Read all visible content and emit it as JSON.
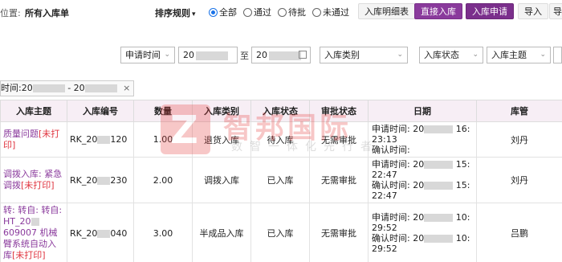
{
  "header": {
    "location_label": "位置:",
    "location_value": "所有入库单",
    "sort_label": "排序规则",
    "sort_caret": "▾",
    "radio_options": [
      "全部",
      "通过",
      "待批",
      "未通过"
    ],
    "radio_selected": "全部",
    "buttons": {
      "detail_table": "入库明细表",
      "direct_inbound": "直接入库",
      "inbound_request": "入库申请",
      "import": "导入",
      "more": "导"
    }
  },
  "filters": {
    "time_type": "申请时间",
    "date_from": "20",
    "to_label": "至",
    "date_to": "20",
    "inbound_category": "入库类别",
    "inbound_status": "入库状态",
    "inbound_subject": "入库主题"
  },
  "chip": {
    "prefix": "时间:20",
    "middle": "- 20",
    "close": "×"
  },
  "table": {
    "columns": [
      "入库主题",
      "入库编号",
      "数量",
      "入库类别",
      "入库状态",
      "审批状态",
      "日期",
      "库管"
    ],
    "rows": [
      {
        "subject": "质量问题",
        "subject_tag": "[未打印]",
        "code_prefix": "RK_20",
        "code_suffix": "120",
        "quantity": "1.00",
        "category": "退货入库",
        "status": "待入库",
        "approval": "无需审批",
        "date_apply_label": "申请时间:",
        "date_apply_prefix": "20",
        "date_apply_suffix": "16:",
        "date_apply_time": "23:13",
        "date_confirm_label": "确认时间:",
        "date_confirm_time": "",
        "keeper": "刘丹"
      },
      {
        "subject": "调拨入库: 紧急调拨",
        "subject_tag": "[未打印]",
        "code_prefix": "RK_20",
        "code_suffix": "230",
        "quantity": "2.00",
        "category": "调拨入库",
        "status": "已入库",
        "approval": "无需审批",
        "date_apply_label": "申请时间:",
        "date_apply_prefix": "20",
        "date_apply_suffix": "15:",
        "date_apply_time": "22:47",
        "date_confirm_label": "确认时间:",
        "date_confirm_prefix": "20",
        "date_confirm_suffix": "15:",
        "date_confirm_time": "22:47",
        "keeper": "刘丹"
      },
      {
        "subject": "转: 转自: 转自: HT_20",
        "subject_line2": "609007 机械臂系统自动入库",
        "subject_tag": "[未打印]",
        "code_prefix": "RK_20",
        "code_suffix": "040",
        "quantity": "3.00",
        "category": "半成品入库",
        "status": "已入库",
        "approval": "无需审批",
        "date_apply_label": "申请时间:",
        "date_apply_prefix": "20",
        "date_apply_suffix": "10:",
        "date_apply_time": "29:52",
        "date_confirm_label": "确认时间:",
        "date_confirm_prefix": "20",
        "date_confirm_suffix": "10:",
        "date_confirm_time": "29:52",
        "keeper": "吕鹏"
      }
    ]
  },
  "watermark": {
    "logo_letter": "Z",
    "title": "智邦国际",
    "subtitle": "数智一体化先行者"
  }
}
